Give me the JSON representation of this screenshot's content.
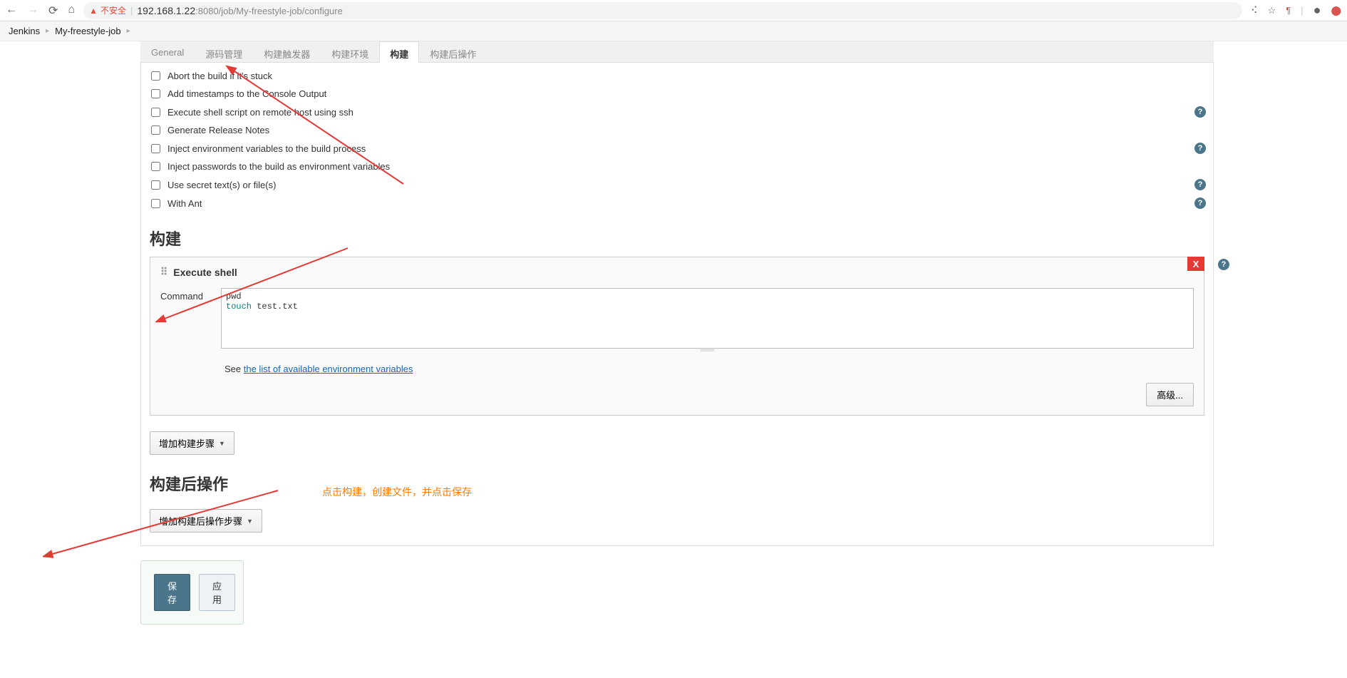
{
  "browser": {
    "insecure_label": "不安全",
    "url_host": "192.168.1.22",
    "url_port": ":8080",
    "url_path": "/job/My-freestyle-job/configure"
  },
  "breadcrumb": {
    "items": [
      "Jenkins",
      "My-freestyle-job"
    ]
  },
  "tabs": {
    "items": [
      {
        "label": "General",
        "active": false
      },
      {
        "label": "源码管理",
        "active": false
      },
      {
        "label": "构建触发器",
        "active": false
      },
      {
        "label": "构建环境",
        "active": false
      },
      {
        "label": "构建",
        "active": true
      },
      {
        "label": "构建后操作",
        "active": false
      }
    ]
  },
  "build_env": {
    "items": [
      {
        "label": "Abort the build if it's stuck",
        "help": false
      },
      {
        "label": "Add timestamps to the Console Output",
        "help": false
      },
      {
        "label": "Execute shell script on remote host using ssh",
        "help": true
      },
      {
        "label": "Generate Release Notes",
        "help": false
      },
      {
        "label": "Inject environment variables to the build process",
        "help": true
      },
      {
        "label": "Inject passwords to the build as environment variables",
        "help": false
      },
      {
        "label": "Use secret text(s) or file(s)",
        "help": true
      },
      {
        "label": "With Ant",
        "help": true
      }
    ]
  },
  "sections": {
    "build_heading": "构建",
    "post_build_heading": "构建后操作"
  },
  "build_step": {
    "title": "Execute shell",
    "command_label": "Command",
    "command_line1": "pwd",
    "command_line2_kw": "touch",
    "command_line2_rest": " test.txt",
    "see_prefix": "See ",
    "see_link": "the list of available environment variables",
    "advanced_label": "高级...",
    "delete_label": "X"
  },
  "buttons": {
    "add_build_step": "增加构建步骤",
    "add_post_build_step": "增加构建后操作步骤",
    "save": "保存",
    "apply": "应用"
  },
  "annotation": {
    "text": "点击构建，创建文件，并点击保存"
  }
}
